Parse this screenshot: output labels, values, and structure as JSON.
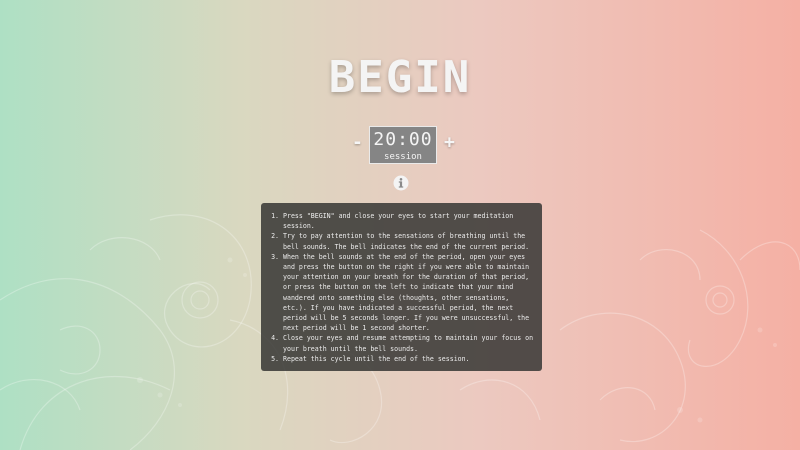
{
  "begin_label": "BEGIN",
  "timer": {
    "minus_label": "-",
    "plus_label": "+",
    "value": "20:00",
    "mode_label": "session"
  },
  "info_icon": "info-icon",
  "instructions": [
    "Press \"BEGIN\" and close your eyes to start your meditation session.",
    "Try to pay attention to the sensations of breathing until the bell sounds. The bell indicates the end of the current period.",
    "When the bell sounds at the end of the period, open your eyes and press the button on the right if you were able to maintain your attention on your breath for the duration of that period, or press the button on the left to indicate that your mind wandered onto something else (thoughts, other sensations, etc.). If you have indicated a successful period, the next period will be 5 seconds longer. If you were unsuccessful, the next period will be 1 second shorter.",
    "Close your eyes and resume attempting to maintain your focus on your breath until the bell sounds.",
    "Repeat this cycle until the end of the session."
  ],
  "colors": {
    "gradient_left": "#aee0c4",
    "gradient_right": "#f5b0a4",
    "panel_bg": "#373734",
    "timer_bg": "#858585",
    "text_light": "#f4f4f4"
  }
}
